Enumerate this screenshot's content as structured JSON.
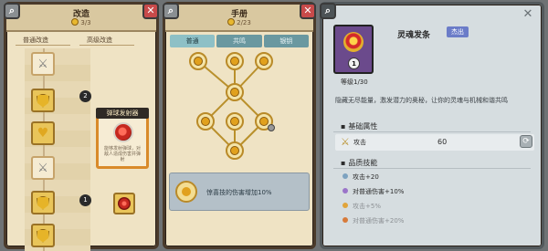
{
  "left": {
    "title": "改造",
    "currency": "3/3",
    "col_normal": "普通改造",
    "col_advanced": "高级改造",
    "badge_top": "2",
    "badge_bottom": "1",
    "popup": {
      "title": "弹球发射器",
      "desc": "能够发射弹球，对敌人造成伤害并弹射"
    },
    "slots": [
      "sword-icon",
      "shield-icon",
      "heart-icon",
      "sword-icon",
      "shield-icon",
      "shield-icon"
    ]
  },
  "mid": {
    "title": "手册",
    "progress": "2/23",
    "tabs": [
      "普通",
      "共鸣",
      "银钥"
    ],
    "active_tab": 0,
    "info_text": "惊喜技的伤害增加10%"
  },
  "right": {
    "item_name": "灵魂发条",
    "rarity": "杰出",
    "level_badge": "1",
    "level_text": "等级1/30",
    "description": "隐藏无尽能量，激发潜力的奥秘，让你的灵魂与机械和谐共鸣",
    "base_attr_title": "基础属性",
    "attr_label": "攻击",
    "attr_value": "60",
    "skill_title": "品质技能",
    "skills": [
      {
        "text": "攻击+20",
        "color": "#7da2c0",
        "dim": false
      },
      {
        "text": "对普通伤害+10%",
        "color": "#9a74c9",
        "dim": false
      },
      {
        "text": "攻击+5%",
        "color": "#e1a43a",
        "dim": true
      },
      {
        "text": "对普通伤害+20%",
        "color": "#d77a3a",
        "dim": true
      }
    ]
  },
  "colors": {
    "panel_bg": "#efe3c4",
    "right_bg": "#d6dde0",
    "tab_active": "#8ec0c6",
    "rarity_badge": "#6b7cc8",
    "purple_card": "#6b4a8c"
  }
}
